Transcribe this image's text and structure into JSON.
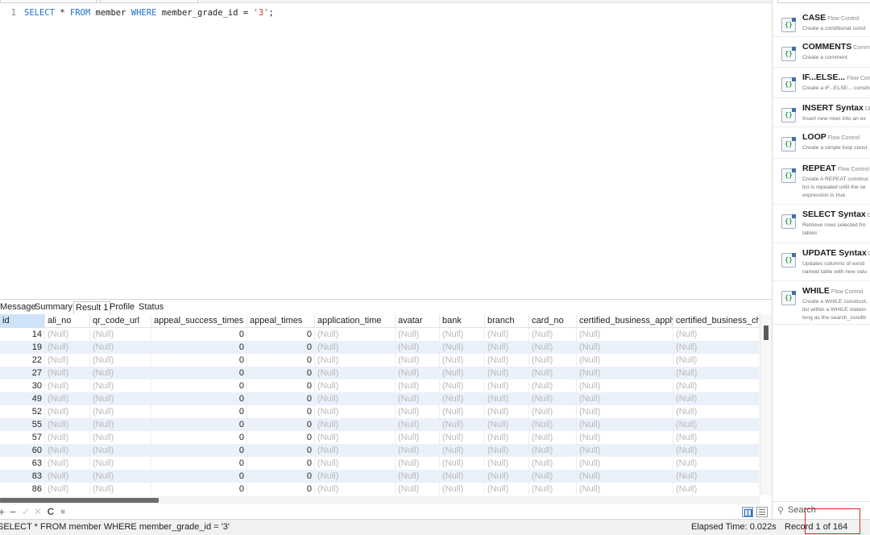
{
  "editor": {
    "line_number": "1",
    "tokens": {
      "t1": "SELECT",
      "t2": " * ",
      "t3": "FROM",
      "t4": " member ",
      "t5": "WHERE",
      "t6": " member_grade_id = ",
      "t7": "'3'",
      "t8": ";"
    }
  },
  "result_tabs": [
    "Message",
    "Summary",
    "Result 1",
    "Profile",
    "Status"
  ],
  "active_result_tab": "Result 1",
  "grid": {
    "columns": [
      "id",
      "ali_no",
      "qr_code_url",
      "appeal_success_times",
      "appeal_times",
      "application_time",
      "avatar",
      "bank",
      "branch",
      "card_no",
      "certified_business_apply_t",
      "certified_business_chec"
    ],
    "null_text": "(Null)",
    "rows": [
      {
        "id": "14",
        "appeal_success_times": "0",
        "appeal_times": "0"
      },
      {
        "id": "19",
        "appeal_success_times": "0",
        "appeal_times": "0"
      },
      {
        "id": "22",
        "appeal_success_times": "0",
        "appeal_times": "0"
      },
      {
        "id": "27",
        "appeal_success_times": "0",
        "appeal_times": "0"
      },
      {
        "id": "30",
        "appeal_success_times": "0",
        "appeal_times": "0"
      },
      {
        "id": "49",
        "appeal_success_times": "0",
        "appeal_times": "0"
      },
      {
        "id": "52",
        "appeal_success_times": "0",
        "appeal_times": "0"
      },
      {
        "id": "55",
        "appeal_success_times": "0",
        "appeal_times": "0"
      },
      {
        "id": "57",
        "appeal_success_times": "0",
        "appeal_times": "0"
      },
      {
        "id": "60",
        "appeal_success_times": "0",
        "appeal_times": "0"
      },
      {
        "id": "63",
        "appeal_success_times": "0",
        "appeal_times": "0"
      },
      {
        "id": "83",
        "appeal_success_times": "0",
        "appeal_times": "0"
      },
      {
        "id": "86",
        "appeal_success_times": "0",
        "appeal_times": "0"
      }
    ]
  },
  "grid_toolbar": {
    "add": "+",
    "remove": "−",
    "apply": "✓",
    "discard": "✕",
    "refresh": "C",
    "stop": "■"
  },
  "status": {
    "sql": "SELECT * FROM member WHERE member_grade_id = '3'",
    "elapsed": "Elapsed Time: 0.022s",
    "record": "Record 1 of 164"
  },
  "snippets": [
    {
      "title": "CASE",
      "category": "Flow Control",
      "desc": "Create a conditional const"
    },
    {
      "title": "COMMENTS",
      "category": "Comme",
      "desc": "Create a comment"
    },
    {
      "title": "IF...ELSE...",
      "category": "Flow Contro",
      "desc": "Create a IF...ELSE... constru"
    },
    {
      "title": "INSERT Syntax",
      "category": "DM",
      "desc": "Insert new rows into an ex"
    },
    {
      "title": "LOOP",
      "category": "Flow Control",
      "desc": "Create a simple loop const"
    },
    {
      "title": "REPEAT",
      "category": "Flow Control",
      "desc": "Create A REPEAT construc list is repeated until the se expression is true."
    },
    {
      "title": "SELECT Syntax",
      "category": "DMI",
      "desc": "Retrieve rows selected fro tables"
    },
    {
      "title": "UPDATE Syntax",
      "category": "DI",
      "desc": "Updates columns of existi named table with new valu"
    },
    {
      "title": "WHILE",
      "category": "Flow Control",
      "desc": "Create a WHILE construct. list within a WHILE statem long as the search_conditi true."
    }
  ],
  "snippet_icon": "code-braces-icon",
  "search": {
    "placeholder": "Search"
  },
  "colors": {
    "keyword": "#1f6fd0",
    "string": "#c0392b",
    "null": "#b9b9b9",
    "row_alt": "#eaf1fb",
    "highlight_box": "#e0242c"
  }
}
